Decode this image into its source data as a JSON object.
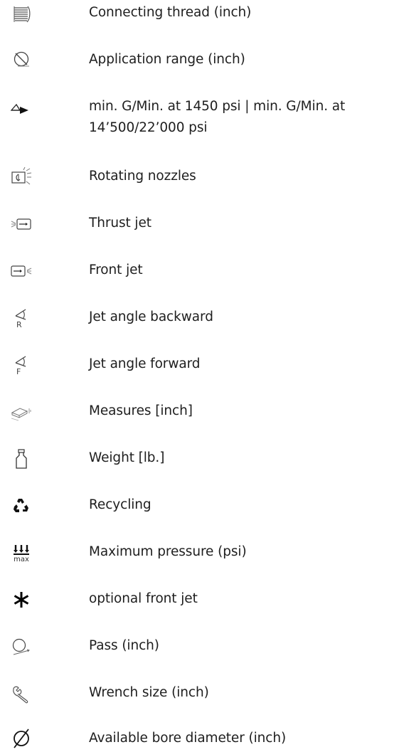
{
  "legend": {
    "items": [
      {
        "icon": "thread-icon",
        "label": "Connecting thread (inch)"
      },
      {
        "icon": "application-range-icon",
        "label": "Application range (inch)"
      },
      {
        "icon": "flow-rate-icon",
        "label": "min. G/Min. at 1450 psi | min. G/Min. at\n14’500/22’000 psi"
      },
      {
        "icon": "rotating-nozzle-icon",
        "label": "Rotating nozzles"
      },
      {
        "icon": "thrust-jet-icon",
        "label": "Thrust jet"
      },
      {
        "icon": "front-jet-icon",
        "label": "Front jet"
      },
      {
        "icon": "jet-angle-backward-icon",
        "label": "Jet angle backward",
        "icon_letter": "R"
      },
      {
        "icon": "jet-angle-forward-icon",
        "label": "Jet angle forward",
        "icon_letter": "F"
      },
      {
        "icon": "measures-icon",
        "label": "Measures [inch]"
      },
      {
        "icon": "weight-icon",
        "label": "Weight [lb.]"
      },
      {
        "icon": "recycling-icon",
        "label": "Recycling"
      },
      {
        "icon": "maximum-pressure-icon",
        "label": "Maximum pressure (psi)",
        "icon_text": "max"
      },
      {
        "icon": "asterisk-icon",
        "label": "optional front jet"
      },
      {
        "icon": "pass-icon",
        "label": "Pass (inch)"
      },
      {
        "icon": "wrench-icon",
        "label": "Wrench size (inch)"
      },
      {
        "icon": "bore-diameter-icon",
        "label": "Available bore diameter (inch)"
      }
    ]
  }
}
